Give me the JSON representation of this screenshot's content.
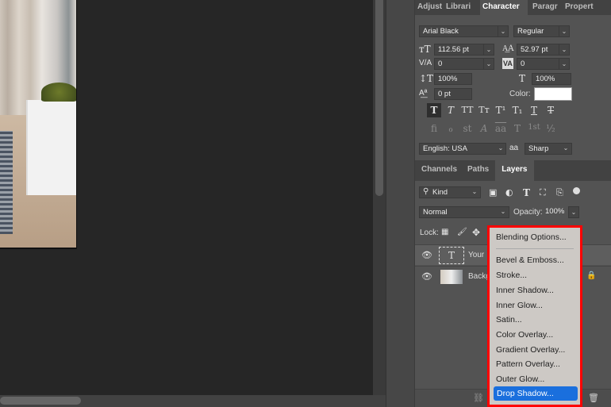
{
  "character_panel": {
    "tabs": [
      "Adjust",
      "Librari",
      "Character",
      "Paragr",
      "Propert"
    ],
    "active_tab": "Character",
    "font_family": "Arial Black",
    "font_style": "Regular",
    "font_size": "112.56 pt",
    "leading": "52.97 pt",
    "kerning": "0",
    "tracking": "0",
    "vertical_scale": "100%",
    "horizontal_scale": "100%",
    "baseline_shift": "0 pt",
    "color_label": "Color:",
    "color_value": "#ffffff",
    "type_styles": [
      "T",
      "T",
      "TT",
      "Tт",
      "T¹",
      "T₁",
      "T",
      "T"
    ],
    "opentype": [
      "fi",
      "ℴ",
      "st",
      "A",
      "aa",
      "T",
      "1st",
      "½"
    ],
    "language": "English: USA",
    "antialias_icon": "aa",
    "antialias": "Sharp"
  },
  "layers_panel": {
    "tabs": [
      "Channels",
      "Paths",
      "Layers"
    ],
    "active_tab": "Layers",
    "filter": "Kind",
    "blend_mode": "Normal",
    "opacity_label": "Opacity:",
    "opacity": "100%",
    "lock_label": "Lock:",
    "layers": [
      {
        "name": "Your",
        "type": "text",
        "thumb": "T"
      },
      {
        "name": "Backg",
        "type": "image",
        "locked": true
      }
    ]
  },
  "context_menu": {
    "items": [
      "Blending Options...",
      "Bevel & Emboss...",
      "Stroke...",
      "Inner Shadow...",
      "Inner Glow...",
      "Satin...",
      "Color Overlay...",
      "Gradient Overlay...",
      "Pattern Overlay...",
      "Outer Glow...",
      "Drop Shadow..."
    ],
    "highlighted": "Drop Shadow...",
    "highlight_color": "#ff0000"
  }
}
